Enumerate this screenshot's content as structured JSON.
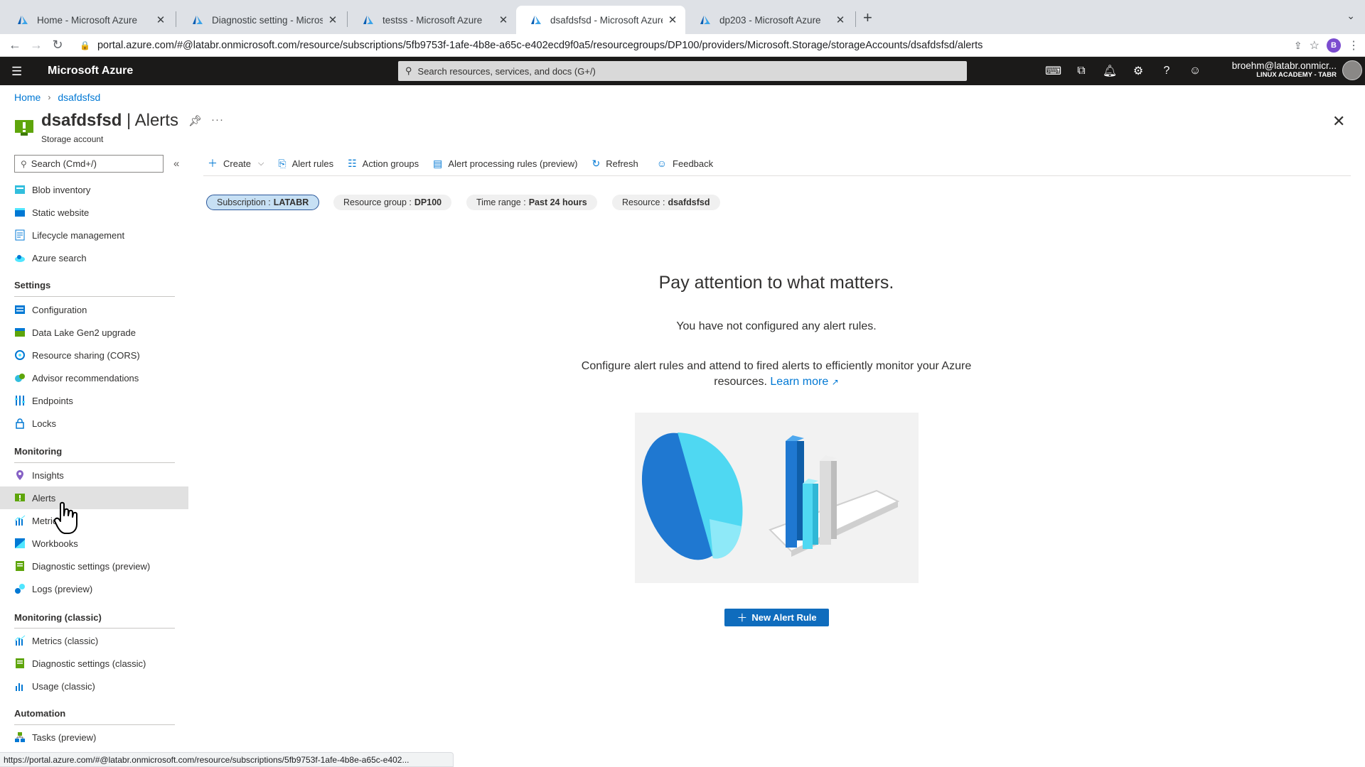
{
  "browser": {
    "tabs": [
      {
        "title": "Home - Microsoft Azure",
        "close": "✕",
        "active": false
      },
      {
        "title": "Diagnostic setting - Microsoft",
        "close": "✕",
        "active": false
      },
      {
        "title": "testss - Microsoft Azure",
        "close": "✕",
        "active": false
      },
      {
        "title": "dsafdsfsd - Microsoft Azure",
        "close": "✕",
        "active": true
      },
      {
        "title": "dp203 - Microsoft Azure",
        "close": "✕",
        "active": false
      }
    ],
    "new_tab": "+",
    "tab_menu": "⌄",
    "url": "portal.azure.com/#@latabr.onmicrosoft.com/resource/subscriptions/5fb9753f-1afe-4b8e-a65c-e402ecd9f0a5/resourcegroups/DP100/providers/Microsoft.Storage/storageAccounts/dsafdsfsd/alerts",
    "profile_initial": "B",
    "status_url": "https://portal.azure.com/#@latabr.onmicrosoft.com/resource/subscriptions/5fb9753f-1afe-4b8e-a65c-e402..."
  },
  "azure": {
    "brand": "Microsoft Azure",
    "search_placeholder": "Search resources, services, and docs (G+/)",
    "user_email": "broehm@latabr.onmicr...",
    "user_tenant": "LINUX ACADEMY - TABR"
  },
  "breadcrumb": [
    "Home",
    "dsafdsfsd"
  ],
  "page": {
    "resource_name": "dsafdsfsd",
    "blade_name": "| Alerts",
    "subtitle": "Storage account"
  },
  "sidebar": {
    "search_placeholder": "Search (Cmd+/)",
    "collapse": "«",
    "top_items": [
      "Blob inventory",
      "Static website",
      "Lifecycle management",
      "Azure search"
    ],
    "sections": [
      {
        "heading": "Settings",
        "items": [
          "Configuration",
          "Data Lake Gen2 upgrade",
          "Resource sharing (CORS)",
          "Advisor recommendations",
          "Endpoints",
          "Locks"
        ]
      },
      {
        "heading": "Monitoring",
        "items": [
          "Insights",
          "Alerts",
          "Metrics",
          "Workbooks",
          "Diagnostic settings (preview)",
          "Logs (preview)"
        ]
      },
      {
        "heading": "Monitoring (classic)",
        "items": [
          "Metrics (classic)",
          "Diagnostic settings (classic)",
          "Usage (classic)"
        ]
      },
      {
        "heading": "Automation",
        "items": [
          "Tasks (preview)"
        ]
      }
    ],
    "active_item": "Alerts"
  },
  "commands": [
    "Create",
    "Alert rules",
    "Action groups",
    "Alert processing rules (preview)",
    "Refresh",
    "Feedback"
  ],
  "filters": [
    {
      "label": "Subscription :",
      "value": "LATABR",
      "selected": true
    },
    {
      "label": "Resource group :",
      "value": "DP100",
      "selected": false
    },
    {
      "label": "Time range :",
      "value": "Past 24 hours",
      "selected": false
    },
    {
      "label": "Resource :",
      "value": "dsafdsfsd",
      "selected": false
    }
  ],
  "empty_state": {
    "title": "Pay attention to what matters.",
    "subtitle": "You have not configured any alert rules.",
    "description": "Configure alert rules and attend to fired alerts to efficiently monitor your Azure resources.",
    "learn_more": "Learn more",
    "button": "New Alert Rule"
  },
  "colors": {
    "accent": "#0078d4",
    "header_bg": "#1b1a19",
    "button_bg": "#0f6cbd",
    "active_nav": "#e1e1e1"
  }
}
